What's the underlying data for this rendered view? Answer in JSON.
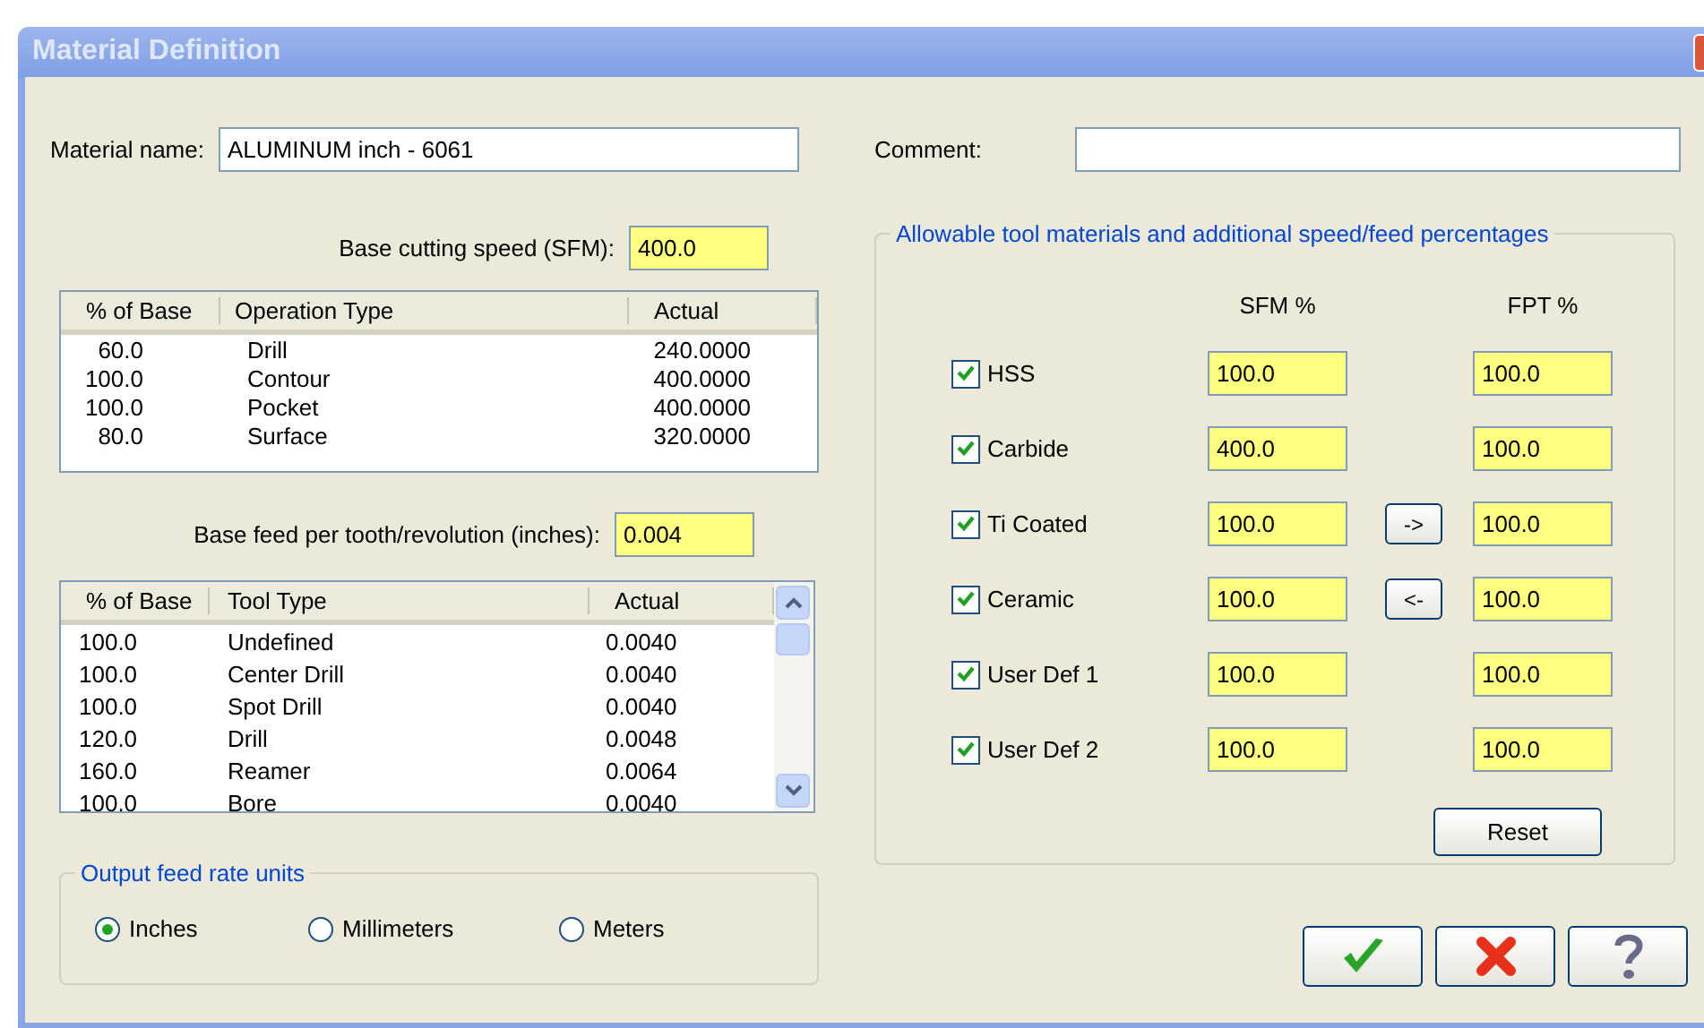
{
  "window": {
    "title": "Material Definition"
  },
  "material_name": {
    "label": "Material name:",
    "value": "ALUMINUM inch - 6061"
  },
  "comment": {
    "label": "Comment:"
  },
  "base_cutting_speed": {
    "label": "Base cutting speed (SFM):",
    "value": "400.0"
  },
  "operations_table": {
    "columns": [
      "% of Base",
      "Operation Type",
      "Actual"
    ],
    "rows": [
      [
        "60.0",
        "Drill",
        "240.0000"
      ],
      [
        "100.0",
        "Contour",
        "400.0000"
      ],
      [
        "100.0",
        "Pocket",
        "400.0000"
      ],
      [
        "80.0",
        "Surface",
        "320.0000"
      ]
    ]
  },
  "base_feed": {
    "label": "Base feed per tooth/revolution (inches):",
    "value": "0.004"
  },
  "tools_table": {
    "columns": [
      "% of Base",
      "Tool Type",
      "Actual"
    ],
    "rows": [
      [
        "100.0",
        "Undefined",
        "0.0040"
      ],
      [
        "100.0",
        "Center Drill",
        "0.0040"
      ],
      [
        "100.0",
        "Spot Drill",
        "0.0040"
      ],
      [
        "120.0",
        "Drill",
        "0.0048"
      ],
      [
        "160.0",
        "Reamer",
        "0.0064"
      ],
      [
        "100.0",
        "Bore",
        "0.0040"
      ]
    ]
  },
  "output_units": {
    "legend": "Output feed rate units",
    "options": [
      {
        "label": "Inches",
        "selected": true
      },
      {
        "label": "Millimeters",
        "selected": false
      },
      {
        "label": "Meters",
        "selected": false
      }
    ]
  },
  "tool_materials": {
    "legend": "Allowable tool materials and additional speed/feed percentages",
    "columns": [
      "SFM %",
      "FPT %"
    ],
    "rows": [
      {
        "label": "HSS",
        "checked": true,
        "sfm": "100.0",
        "fpt": "100.0"
      },
      {
        "label": "Carbide",
        "checked": true,
        "sfm": "400.0",
        "fpt": "100.0"
      },
      {
        "label": "Ti Coated",
        "checked": true,
        "sfm": "100.0",
        "fpt": "100.0",
        "transfer": "->"
      },
      {
        "label": "Ceramic",
        "checked": true,
        "sfm": "100.0",
        "fpt": "100.0",
        "transfer": "<-"
      },
      {
        "label": "User Def 1",
        "checked": true,
        "sfm": "100.0",
        "fpt": "100.0"
      },
      {
        "label": "User Def 2",
        "checked": true,
        "sfm": "100.0",
        "fpt": "100.0"
      }
    ],
    "reset": "Reset"
  },
  "dialog_buttons": [
    {
      "kind": "ok"
    },
    {
      "kind": "cancel"
    },
    {
      "kind": "help"
    }
  ]
}
